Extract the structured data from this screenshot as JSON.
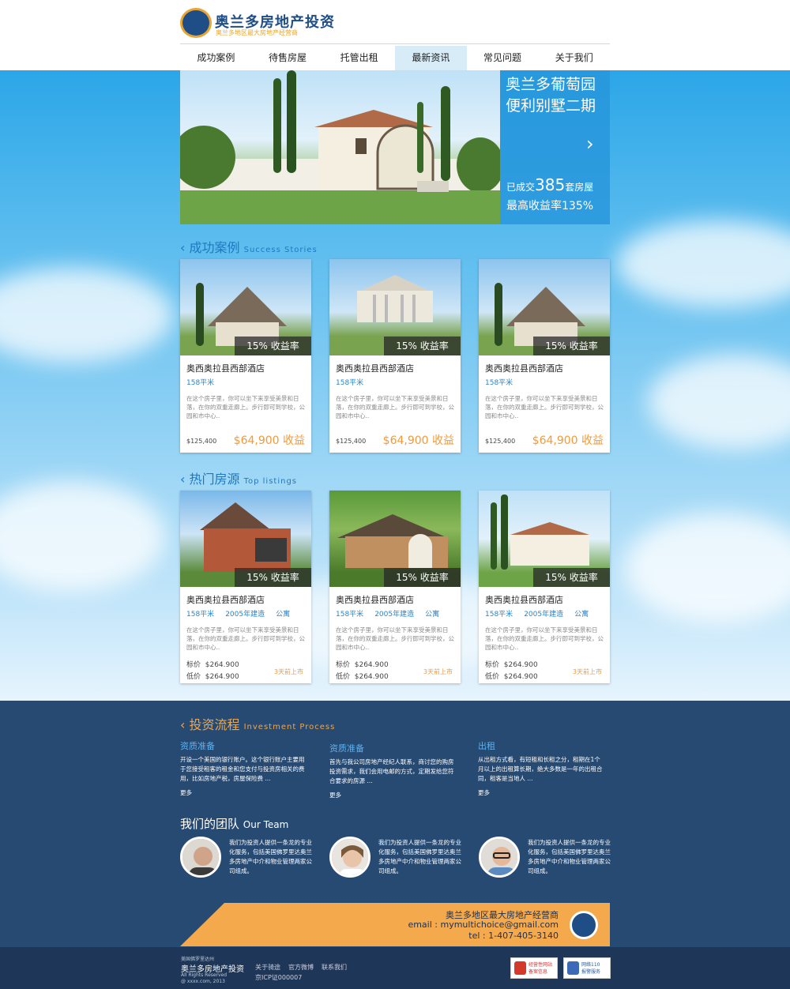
{
  "header": {
    "title": "奥兰多房地产投资",
    "subtitle": "奥兰多地区最大房地产经营商"
  },
  "nav": [
    "成功案例",
    "待售房屋",
    "托管出租",
    "最新资讯",
    "常见问题",
    "关于我们"
  ],
  "hero": {
    "title_line1": "奥兰多葡萄园",
    "title_line2": "便利别墅二期",
    "stat_prefix": "已成交",
    "stat_count": "385",
    "stat_suffix": "套房屋",
    "stat2": "最高收益率135%",
    "arrow": "›"
  },
  "success": {
    "title": "成功案例",
    "title_en": "Success Stories",
    "cards": [
      {
        "badge": "15% 收益率",
        "name": "奥西奥拉县西部酒店",
        "area": "158平米",
        "desc": "在这个房子里，你可以坐下来享受美景和日落，在你的双重走廊上。步行即可到学校，公园和市中心..",
        "price": "$125,400",
        "gain": "$64,900 收益"
      },
      {
        "badge": "15% 收益率",
        "name": "奥西奥拉县西部酒店",
        "area": "158平米",
        "desc": "在这个房子里，你可以坐下来享受美景和日落，在你的双重走廊上。步行即可到学校，公园和市中心..",
        "price": "$125,400",
        "gain": "$64,900 收益"
      },
      {
        "badge": "15% 收益率",
        "name": "奥西奥拉县西部酒店",
        "area": "158平米",
        "desc": "在这个房子里，你可以坐下来享受美景和日落，在你的双重走廊上。步行即可到学校，公园和市中心..",
        "price": "$125,400",
        "gain": "$64,900 收益"
      }
    ]
  },
  "top": {
    "title": "热门房源",
    "title_en": "Top listings",
    "cards": [
      {
        "badge": "15% 收益率",
        "name": "奥西奥拉县西部酒店",
        "area": "158平米",
        "year": "2005年建造",
        "type": "公寓",
        "desc": "在这个房子里，你可以坐下来享受美景和日落，在你的双重走廊上。步行即可到学校，公园和市中心..",
        "list_label": "标价",
        "list_price": "$264.900",
        "low_label": "低价",
        "low_price": "$264.900",
        "ago": "3天前上市"
      },
      {
        "badge": "15% 收益率",
        "name": "奥西奥拉县西部酒店",
        "area": "158平米",
        "year": "2005年建造",
        "type": "公寓",
        "desc": "在这个房子里，你可以坐下来享受美景和日落，在你的双重走廊上。步行即可到学校，公园和市中心..",
        "list_label": "标价",
        "list_price": "$264.900",
        "low_label": "低价",
        "low_price": "$264.900",
        "ago": "3天前上市"
      },
      {
        "badge": "15% 收益率",
        "name": "奥西奥拉县西部酒店",
        "area": "158平米",
        "year": "2005年建造",
        "type": "公寓",
        "desc": "在这个房子里，你可以坐下来享受美景和日落，在你的双重走廊上。步行即可到学校，公园和市中心..",
        "list_label": "标价",
        "list_price": "$264.900",
        "low_label": "低价",
        "low_price": "$264.900",
        "ago": "3天前上市"
      }
    ]
  },
  "process": {
    "title": "投资流程",
    "title_en": "Investment Process",
    "items": [
      {
        "head": "资质准备",
        "text": "开设一个美国的银行账户。这个银行账户主要用于您接受租客的租金和您支付与投资房相关的费用，比如房地产税，房屋保险费 ...",
        "more": "更多"
      },
      {
        "head": "资质准备",
        "text": "首先与我公司房地产经纪人联系，商讨您的购房投资需求，我们会用电邮的方式，定期发给您符合要求的房源 ...",
        "more": "更多"
      },
      {
        "head": "出租",
        "text": "从出租方式看，有短租和长租之分，租期在1个月以上的出租算长期，绝大多数是一年的出租合同，租客是当地人 ...",
        "more": "更多"
      }
    ]
  },
  "team": {
    "title": "我们的团队",
    "title_en": "Our Team",
    "members": [
      {
        "text": "我们为投资人提供一条龙的专业化服务，包括美国佛罗里达奥兰多房地产中介和物业管理两家公司组成。"
      },
      {
        "text": "我们为投资人提供一条龙的专业化服务，包括美国佛罗里达奥兰多房地产中介和物业管理两家公司组成。"
      },
      {
        "text": "我们为投资人提供一条龙的专业化服务，包括美国佛罗里达奥兰多房地产中介和物业管理两家公司组成。"
      }
    ]
  },
  "contact": {
    "line1": "奥兰多地区最大房地产经营商",
    "email": "email : mymultichoice@gmail.com",
    "tel": "tel : 1-407-405-3140"
  },
  "footer": {
    "location": "美国佛罗里达州",
    "brand": "奥兰多房地产投资",
    "rights": "All Rights Reserved",
    "copyright": "@ xxxx.com, 2013",
    "links": [
      "关于骑途",
      "官方微博",
      "联系我们"
    ],
    "icp": "京ICP证000007",
    "badge1_line1": "经营性网站",
    "badge1_line2": "备案信息",
    "badge2_line1": "网络110",
    "badge2_line2": "报警服务"
  },
  "colors": {
    "brand": "#1f4e86",
    "accent": "#f4a94c",
    "link": "#2a83c8",
    "dark_bg": "#274a73"
  }
}
